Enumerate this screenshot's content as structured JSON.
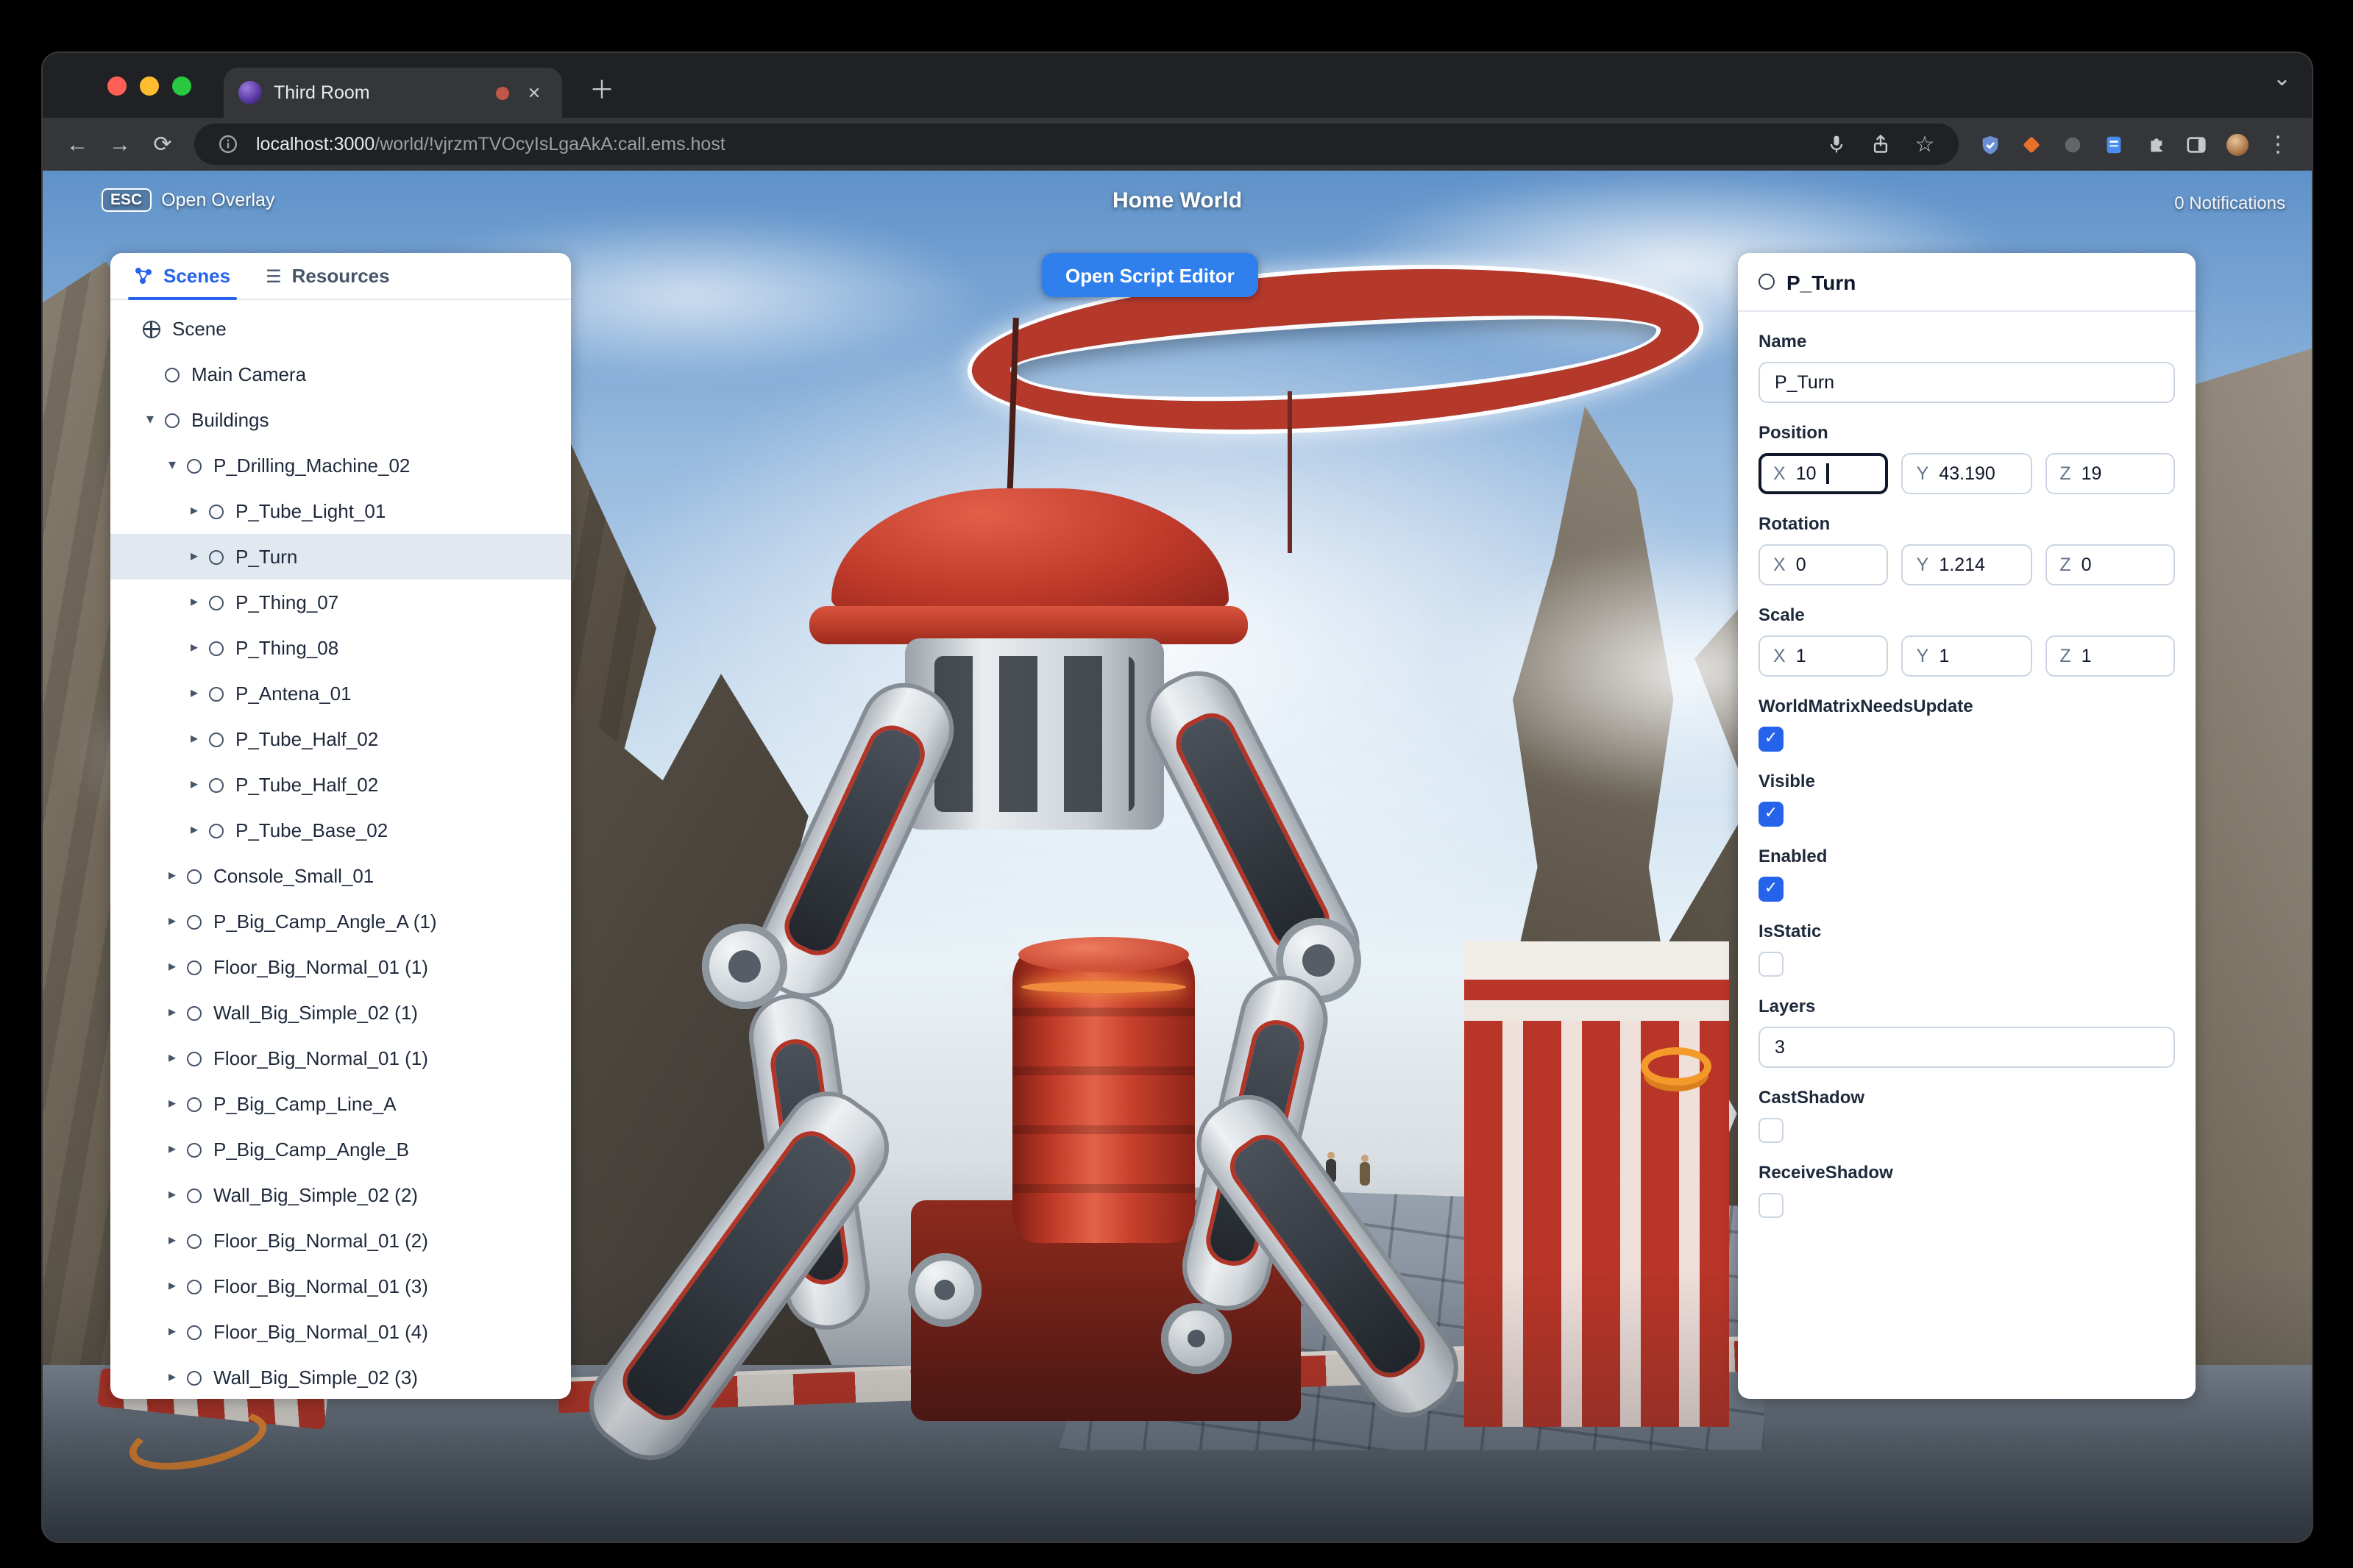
{
  "glyphs": {
    "back": "←",
    "forward": "→",
    "reload": "⟳",
    "close": "✕",
    "plus": "＋",
    "chevron_down": "⌄",
    "kebab": "⋮",
    "star": "☆",
    "menu": "☰",
    "caret_down": "▾",
    "caret_right": "▸",
    "check": "✓"
  },
  "colors": {
    "accent_blue": "#2f80ed",
    "checkbox_blue": "#2563eb",
    "tab_active_blue": "#2563eb",
    "selection_bg": "#e2e8f0",
    "machine_red": "#b5392b"
  },
  "browser": {
    "tab_title": "Third Room",
    "url_domain": "localhost:3000",
    "url_path": "/world/!vjrzmTVOcyIsLgaAkA:call.ems.host"
  },
  "hud": {
    "esc_key": "ESC",
    "esc_label": "Open Overlay",
    "title": "Home World",
    "notifications": "0 Notifications",
    "script_editor_button": "Open Script Editor"
  },
  "left_panel": {
    "tabs": {
      "scenes": "Scenes",
      "resources": "Resources"
    },
    "tree": [
      {
        "label": "Scene",
        "indent": 0,
        "icon": "globe",
        "caret": "none"
      },
      {
        "label": "Main Camera",
        "indent": 1,
        "icon": "circle",
        "caret": "none"
      },
      {
        "label": "Buildings",
        "indent": 1,
        "icon": "circle",
        "caret": "down"
      },
      {
        "label": "P_Drilling_Machine_02",
        "indent": 2,
        "icon": "circle",
        "caret": "down"
      },
      {
        "label": "P_Tube_Light_01",
        "indent": 3,
        "icon": "circle",
        "caret": "right"
      },
      {
        "label": "P_Turn",
        "indent": 3,
        "icon": "circle",
        "caret": "right",
        "selected": true
      },
      {
        "label": "P_Thing_07",
        "indent": 3,
        "icon": "circle",
        "caret": "right"
      },
      {
        "label": "P_Thing_08",
        "indent": 3,
        "icon": "circle",
        "caret": "right"
      },
      {
        "label": "P_Antena_01",
        "indent": 3,
        "icon": "circle",
        "caret": "right"
      },
      {
        "label": "P_Tube_Half_02",
        "indent": 3,
        "icon": "circle",
        "caret": "right"
      },
      {
        "label": "P_Tube_Half_02",
        "indent": 3,
        "icon": "circle",
        "caret": "right"
      },
      {
        "label": "P_Tube_Base_02",
        "indent": 3,
        "icon": "circle",
        "caret": "right"
      },
      {
        "label": "Console_Small_01",
        "indent": 2,
        "icon": "circle",
        "caret": "right"
      },
      {
        "label": "P_Big_Camp_Angle_A (1)",
        "indent": 2,
        "icon": "circle",
        "caret": "right"
      },
      {
        "label": "Floor_Big_Normal_01 (1)",
        "indent": 2,
        "icon": "circle",
        "caret": "right"
      },
      {
        "label": "Wall_Big_Simple_02 (1)",
        "indent": 2,
        "icon": "circle",
        "caret": "right"
      },
      {
        "label": "Floor_Big_Normal_01 (1)",
        "indent": 2,
        "icon": "circle",
        "caret": "right"
      },
      {
        "label": "P_Big_Camp_Line_A",
        "indent": 2,
        "icon": "circle",
        "caret": "right"
      },
      {
        "label": "P_Big_Camp_Angle_B",
        "indent": 2,
        "icon": "circle",
        "caret": "right"
      },
      {
        "label": "Wall_Big_Simple_02 (2)",
        "indent": 2,
        "icon": "circle",
        "caret": "right"
      },
      {
        "label": "Floor_Big_Normal_01 (2)",
        "indent": 2,
        "icon": "circle",
        "caret": "right"
      },
      {
        "label": "Floor_Big_Normal_01 (3)",
        "indent": 2,
        "icon": "circle",
        "caret": "right"
      },
      {
        "label": "Floor_Big_Normal_01 (4)",
        "indent": 2,
        "icon": "circle",
        "caret": "right"
      },
      {
        "label": "Wall_Big_Simple_02 (3)",
        "indent": 2,
        "icon": "circle",
        "caret": "right"
      }
    ]
  },
  "inspector": {
    "title": "P_Turn",
    "axis_labels": {
      "x": "X",
      "y": "Y",
      "z": "Z"
    },
    "name": {
      "label": "Name",
      "value": "P_Turn"
    },
    "position": {
      "label": "Position",
      "x": "10",
      "y": "43.190",
      "z": "19"
    },
    "rotation": {
      "label": "Rotation",
      "x": "0",
      "y": "1.214",
      "z": "0"
    },
    "scale": {
      "label": "Scale",
      "x": "1",
      "y": "1",
      "z": "1"
    },
    "flags_top": [
      {
        "label": "WorldMatrixNeedsUpdate",
        "checked": true
      },
      {
        "label": "Visible",
        "checked": true
      },
      {
        "label": "Enabled",
        "checked": true
      },
      {
        "label": "IsStatic",
        "checked": false
      }
    ],
    "layers": {
      "label": "Layers",
      "value": "3"
    },
    "flags_bottom": [
      {
        "label": "CastShadow",
        "checked": false
      },
      {
        "label": "ReceiveShadow",
        "checked": false
      }
    ]
  }
}
